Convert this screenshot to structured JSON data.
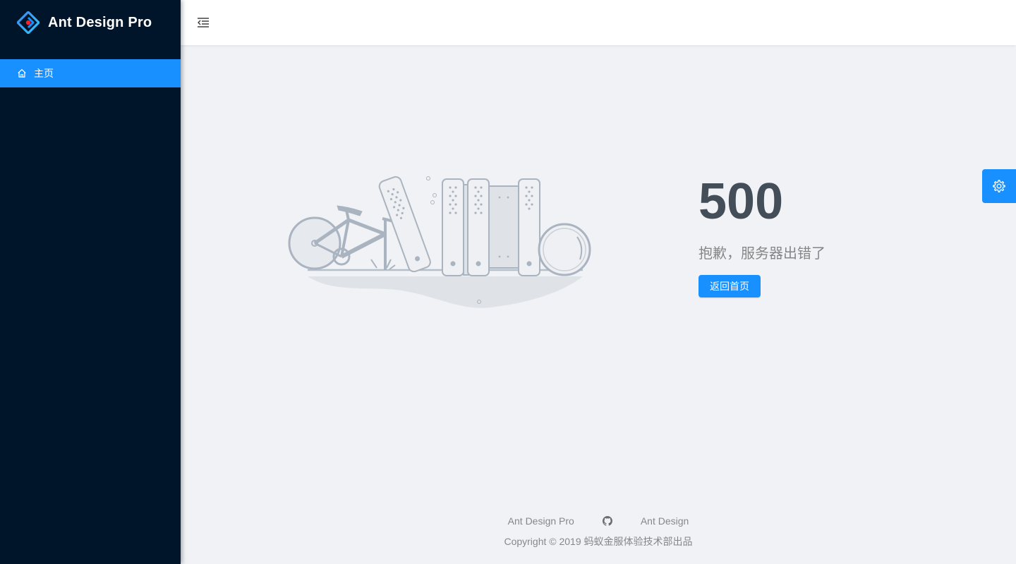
{
  "app": {
    "title": "Ant Design Pro"
  },
  "sidebar": {
    "items": [
      {
        "label": "主页",
        "icon": "home-icon",
        "selected": true
      }
    ]
  },
  "header": {
    "trigger_icon": "menu-fold-icon"
  },
  "exception": {
    "code": "500",
    "description": "抱歉，服务器出错了",
    "back_button": "返回首页",
    "illustration": "broken-bicycle-and-books"
  },
  "setting_drawer": {
    "icon": "setting-icon"
  },
  "footer": {
    "links": [
      {
        "label": "Ant Design Pro"
      },
      {
        "label": "",
        "icon": "github-icon"
      },
      {
        "label": "Ant Design"
      }
    ],
    "copyright_prefix": "Copyright",
    "copyright_text": "2019 蚂蚁金服体验技术部出品"
  },
  "colors": {
    "primary": "#1890ff",
    "sider_bg": "#001529",
    "page_bg": "#f0f2f5",
    "code_text": "#434e59"
  }
}
